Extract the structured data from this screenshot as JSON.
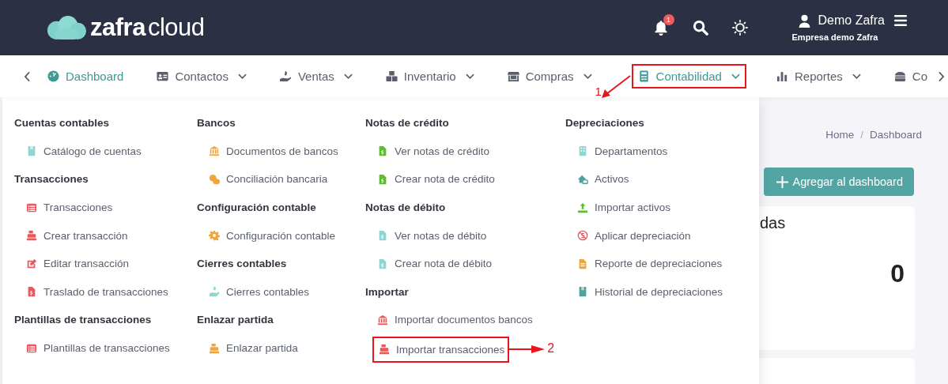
{
  "header": {
    "logo": {
      "bold": "zafra",
      "light": "cloud"
    },
    "notifications": {
      "count": "1"
    },
    "user": {
      "name": "Demo Zafra",
      "company": "Empresa demo Zafra"
    }
  },
  "nav": {
    "items": [
      {
        "label": "Dashboard",
        "selected": true,
        "has_caret": false
      },
      {
        "label": "Contactos",
        "selected": false,
        "has_caret": true
      },
      {
        "label": "Ventas",
        "selected": false,
        "has_caret": true
      },
      {
        "label": "Inventario",
        "selected": false,
        "has_caret": true
      },
      {
        "label": "Compras",
        "selected": false,
        "has_caret": true
      },
      {
        "label": "Contabilidad",
        "selected": true,
        "has_caret": true,
        "annotation": "1"
      },
      {
        "label": "Reportes",
        "selected": false,
        "has_caret": true
      },
      {
        "label": "Co",
        "selected": false,
        "has_caret": false
      }
    ]
  },
  "menu": {
    "columns": [
      [
        {
          "heading": "Cuentas contables",
          "items": [
            {
              "label": "Catálogo de cuentas"
            }
          ]
        },
        {
          "heading": "Transacciones",
          "items": [
            {
              "label": "Transacciones"
            },
            {
              "label": "Crear transacción"
            },
            {
              "label": "Editar transacción"
            },
            {
              "label": "Traslado de transacciones"
            }
          ]
        },
        {
          "heading": "Plantillas de transacciones",
          "items": [
            {
              "label": "Plantillas de transacciones"
            }
          ]
        }
      ],
      [
        {
          "heading": "Bancos",
          "items": [
            {
              "label": "Documentos de bancos"
            },
            {
              "label": "Conciliación bancaria"
            }
          ]
        },
        {
          "heading": "Configuración contable",
          "items": [
            {
              "label": "Configuración contable"
            }
          ]
        },
        {
          "heading": "Cierres contables",
          "items": [
            {
              "label": "Cierres contables"
            }
          ]
        },
        {
          "heading": "Enlazar partida",
          "items": [
            {
              "label": "Enlazar partida"
            }
          ]
        }
      ],
      [
        {
          "heading": "Notas de crédito",
          "items": [
            {
              "label": "Ver notas de crédito"
            },
            {
              "label": "Crear nota de crédito"
            }
          ]
        },
        {
          "heading": "Notas de débito",
          "items": [
            {
              "label": "Ver notas de débito"
            },
            {
              "label": "Crear nota de débito"
            }
          ]
        },
        {
          "heading": "Importar",
          "items": [
            {
              "label": "Importar documentos bancos"
            },
            {
              "label": "Importar transacciones",
              "annotation": "2"
            }
          ]
        }
      ],
      [
        {
          "heading": "Depreciaciones",
          "items": [
            {
              "label": "Departamentos"
            },
            {
              "label": "Activos"
            },
            {
              "label": "Importar activos"
            },
            {
              "label": "Aplicar depreciación"
            },
            {
              "label": "Reporte de depreciaciones"
            },
            {
              "label": "Historial de depreciaciones"
            }
          ]
        }
      ]
    ]
  },
  "breadcrumb": {
    "items": [
      "Home",
      "Dashboard"
    ],
    "separator": "/"
  },
  "add_button": "Agregar al dashboard",
  "card": {
    "title": "das",
    "value": "0"
  }
}
